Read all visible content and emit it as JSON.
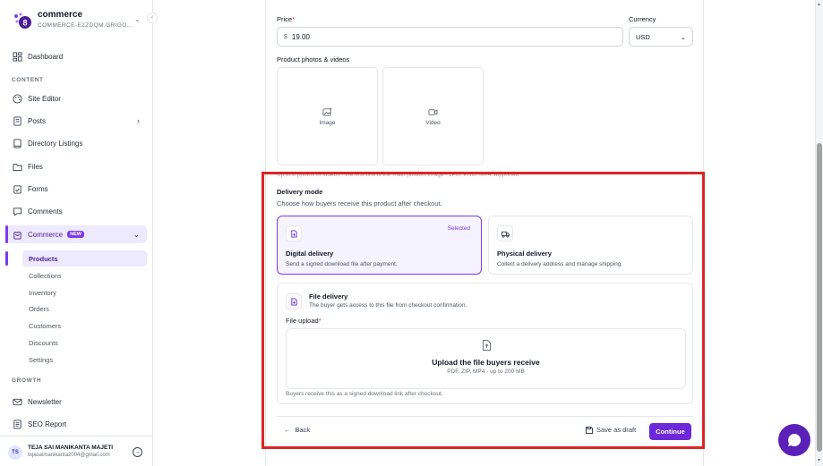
{
  "brand": {
    "name": "commerce",
    "subtitle": "COMMERCE-E2ZDQM.GRIGO..."
  },
  "sidebar": {
    "dashboard": "Dashboard",
    "section_content": "CONTENT",
    "site_editor": "Site Editor",
    "posts": "Posts",
    "directory_listings": "Directory Listings",
    "files": "Files",
    "forms": "Forms",
    "comments": "Comments",
    "commerce": "Commerce",
    "commerce_badge": "NEW",
    "commerce_items": [
      "Products",
      "Collections",
      "Inventory",
      "Orders",
      "Customers",
      "Discounts",
      "Settings"
    ],
    "section_growth": "GROWTH",
    "newsletter": "Newsletter",
    "seo_report": "SEO Report"
  },
  "user": {
    "initials": "TS",
    "name": "TEJA SAI MANIKANTA MAJETI",
    "email": "tejasaimanikanta2004@gmail.com"
  },
  "form": {
    "price_label": "Price",
    "price_symbol": "$",
    "price_value": "19.00",
    "currency_label": "Currency",
    "currency_value": "USD",
    "photos_label": "Product photos & videos",
    "image_label": "Image",
    "video_label": "Video",
    "photos_hint": "Up to 8 photos or videos · the first one is the main product image · JPG, PNG, MP4 supported",
    "delivery_title": "Delivery mode",
    "delivery_subtitle": "Choose how buyers receive this product after checkout.",
    "digital": {
      "title": "Digital delivery",
      "desc": "Send a signed download file after payment.",
      "selected_label": "Selected"
    },
    "physical": {
      "title": "Physical delivery",
      "desc": "Collect a delivery address and manage shipping."
    },
    "file_delivery": {
      "title": "File delivery",
      "desc": "The buyer gets access to this file from checkout confirmation.",
      "upload_label": "File upload",
      "upload_title": "Upload the file buyers receive",
      "upload_sub": "PDF, ZIP, MP4 · up to 200 MB",
      "note": "Buyers receive this as a signed download link after checkout."
    },
    "back": "Back",
    "save_draft": "Save as draft",
    "continue": "Continue"
  },
  "colors": {
    "accent": "#6d28d9",
    "highlight": "#dc2626"
  }
}
